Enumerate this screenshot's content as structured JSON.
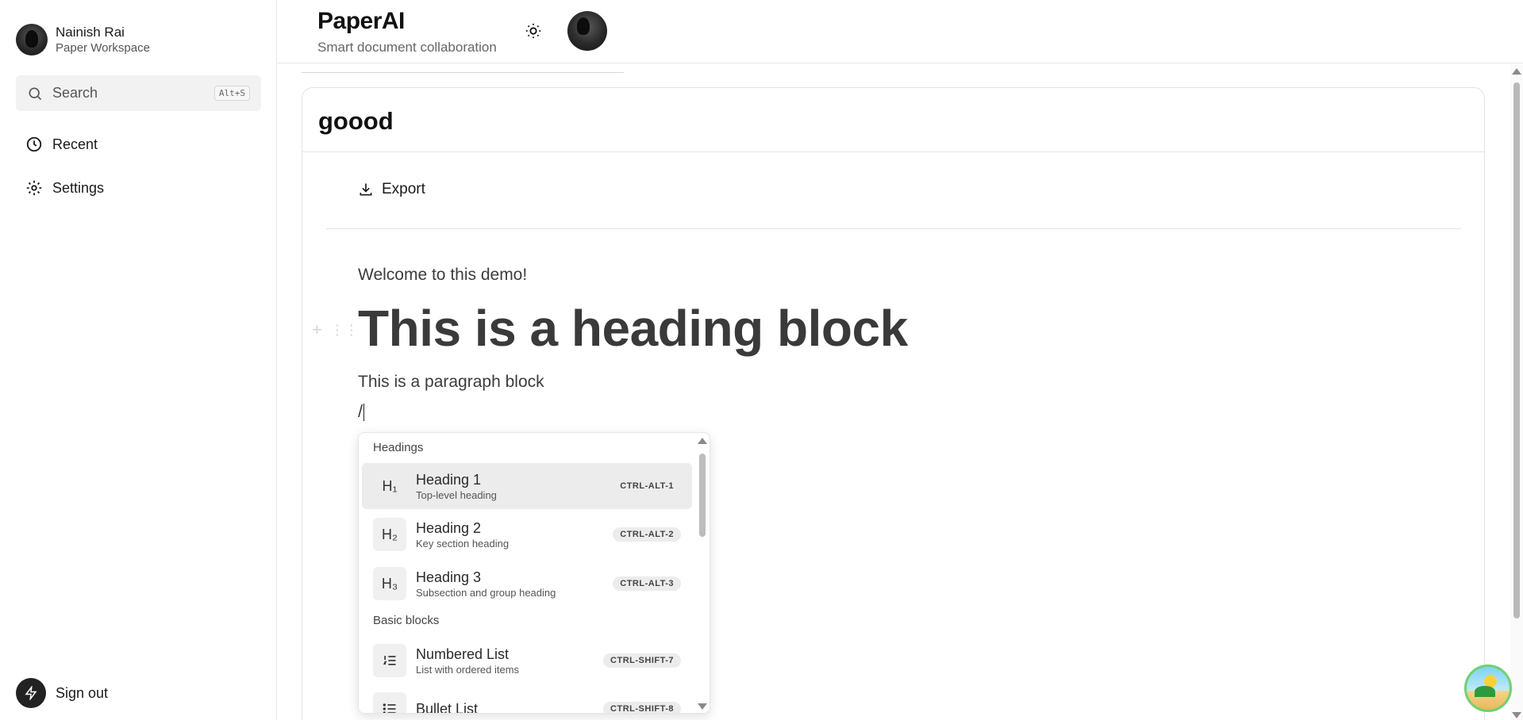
{
  "sidebar": {
    "user_name": "Nainish Rai",
    "workspace": "Paper Workspace",
    "search_label": "Search",
    "search_shortcut": "Alt+S",
    "nav": [
      {
        "label": "Recent",
        "icon": "clock-icon"
      },
      {
        "label": "Settings",
        "icon": "gear-icon"
      }
    ],
    "signout_label": "Sign out"
  },
  "header": {
    "title": "PaperAI",
    "subtitle": "Smart document collaboration"
  },
  "document": {
    "title": "goood",
    "export_label": "Export",
    "blocks": {
      "para1": "Welcome to this demo!",
      "heading": "This is a heading block",
      "para2": "This is a paragraph block",
      "slash": "/"
    }
  },
  "slash_menu": {
    "groups": [
      {
        "label": "Headings"
      },
      {
        "label": "Basic blocks"
      }
    ],
    "items": [
      {
        "glyph": "H₁",
        "title": "Heading 1",
        "subtitle": "Top-level heading",
        "shortcut": "CTRL-ALT-1",
        "active": true
      },
      {
        "glyph": "H₂",
        "title": "Heading 2",
        "subtitle": "Key section heading",
        "shortcut": "CTRL-ALT-2"
      },
      {
        "glyph": "H₃",
        "title": "Heading 3",
        "subtitle": "Subsection and group heading",
        "shortcut": "CTRL-ALT-3"
      },
      {
        "glyph": "ordered-list-icon",
        "title": "Numbered List",
        "subtitle": "List with ordered items",
        "shortcut": "CTRL-SHIFT-7"
      },
      {
        "glyph": "bullet-list-icon",
        "title": "Bullet List",
        "subtitle": "",
        "shortcut": "CTRL-SHIFT-8"
      }
    ]
  },
  "colors": {
    "accent": "#1a1a1a",
    "active_item_bg": "#ececec",
    "border": "#e5e5e5"
  }
}
